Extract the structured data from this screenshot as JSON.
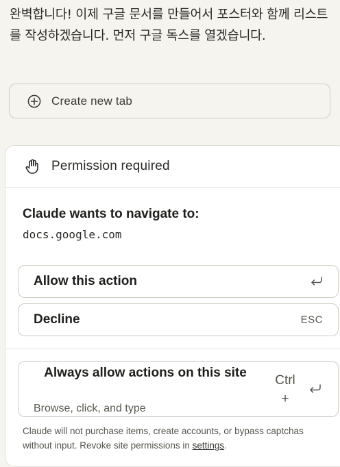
{
  "message": {
    "text": "완벽합니다! 이제 구글 문서를 만들어서 포스터와 함께 리스트를 작성하겠습니다. 먼저 구글 독스를 열겠습니다."
  },
  "create_tab": {
    "icon": "plus-circle-icon",
    "label": "Create new tab"
  },
  "permission": {
    "icon": "hand-icon",
    "title": "Permission required",
    "heading": "Claude wants to navigate to:",
    "url": "docs.google.com",
    "allow": {
      "label": "Allow this action",
      "icon": "return-icon"
    },
    "decline": {
      "label": "Decline",
      "shortcut": "ESC"
    },
    "always": {
      "title": "Always allow actions on this site",
      "subtitle": "Browse, click, and type",
      "shortcut_key": "Ctrl",
      "shortcut_plus": "+",
      "icon": "return-icon"
    },
    "footnote": {
      "text": "Claude will not purchase items, create accounts, or bypass captchas without input. Revoke site permissions in ",
      "link": "settings",
      "end": "."
    }
  },
  "colors": {
    "background": "#f5f4ef",
    "panel": "#ffffff",
    "border": "#cfcdc4",
    "text": "#1f1e1b",
    "muted": "#55534d"
  }
}
